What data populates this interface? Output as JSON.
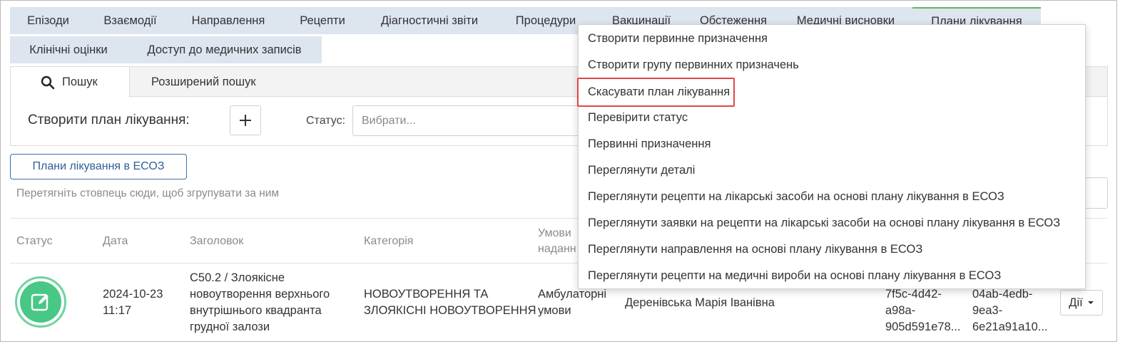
{
  "tabs_row1": [
    {
      "label": "Епізоди"
    },
    {
      "label": "Взаємодії"
    },
    {
      "label": "Направлення"
    },
    {
      "label": "Рецепти"
    },
    {
      "label": "Діагностичні звіти"
    },
    {
      "label": "Процедури"
    },
    {
      "label": "Вакцинації"
    },
    {
      "label": "Обстеження"
    },
    {
      "label": "Медичні висновки"
    },
    {
      "label": "Плани лікування"
    }
  ],
  "tabs_row2": [
    {
      "label": "Клінічні оцінки"
    },
    {
      "label": "Доступ до медичних записів"
    }
  ],
  "subtabs": {
    "search": "Пошук",
    "advanced": "Розширений пошук"
  },
  "form": {
    "create_label": "Створити план лікування:",
    "status_label": "Статус:",
    "status_placeholder": "Вибрати..."
  },
  "eco_button": "Плани лікування в ЕСОЗ",
  "group_hint": "Перетягніть стовпець сюди, щоб згрупувати за ним",
  "table": {
    "headers": {
      "status": "Статус",
      "date": "Дата",
      "title": "Заголовок",
      "category": "Категорія",
      "conditions_1": "Умови",
      "conditions_2": "наданн"
    },
    "row": {
      "date_1": "2024-10-23",
      "date_2": "11:17",
      "title_1": "C50.2 / Злоякісне",
      "title_2": "новоутворення верхнього",
      "title_3": "внутрішнього квадранта",
      "title_4": "грудної залози",
      "category_1": "НОВОУТВОРЕННЯ ТА",
      "category_2": "ЗЛОЯКІСНІ НОВОУТВОРЕННЯ",
      "conditions_1": "Амбулаторні",
      "conditions_2": "умови",
      "doctor": "Деренівська Марія Іванівна",
      "id1_1": "7f5c-4d42-",
      "id1_2": "a98a-",
      "id1_3": "905d591e78...",
      "id2_1": "04ab-4edb-",
      "id2_2": "9ea3-",
      "id2_3": "6e21a91a10...",
      "actions": "Дії"
    }
  },
  "dropdown": [
    "Створити первинне призначення",
    "Створити групу первинних призначень",
    "Скасувати план лікування",
    "Перевірити статус",
    "Первинні призначення",
    "Переглянути деталі",
    "Переглянути рецепти на лікарські засоби на основі плану лікування в ЕСОЗ",
    "Переглянути заявки на рецепти на лікарські засоби на основі плану лікування в ЕСОЗ",
    "Переглянути направлення на основі плану лікування в ЕСОЗ",
    "Переглянути рецепти на медичні вироби на основі плану лікування в ЕСОЗ"
  ],
  "colors": {
    "tab_bg": "#dde5ef",
    "active_tab_accent": "#5cb85c",
    "status_icon": "#49c785",
    "highlight": "#e04646",
    "link_blue": "#2f5f96"
  },
  "icons": {
    "search": "search-icon",
    "plus": "plus-icon",
    "status": "edit-icon",
    "caret": "caret-down-icon"
  }
}
